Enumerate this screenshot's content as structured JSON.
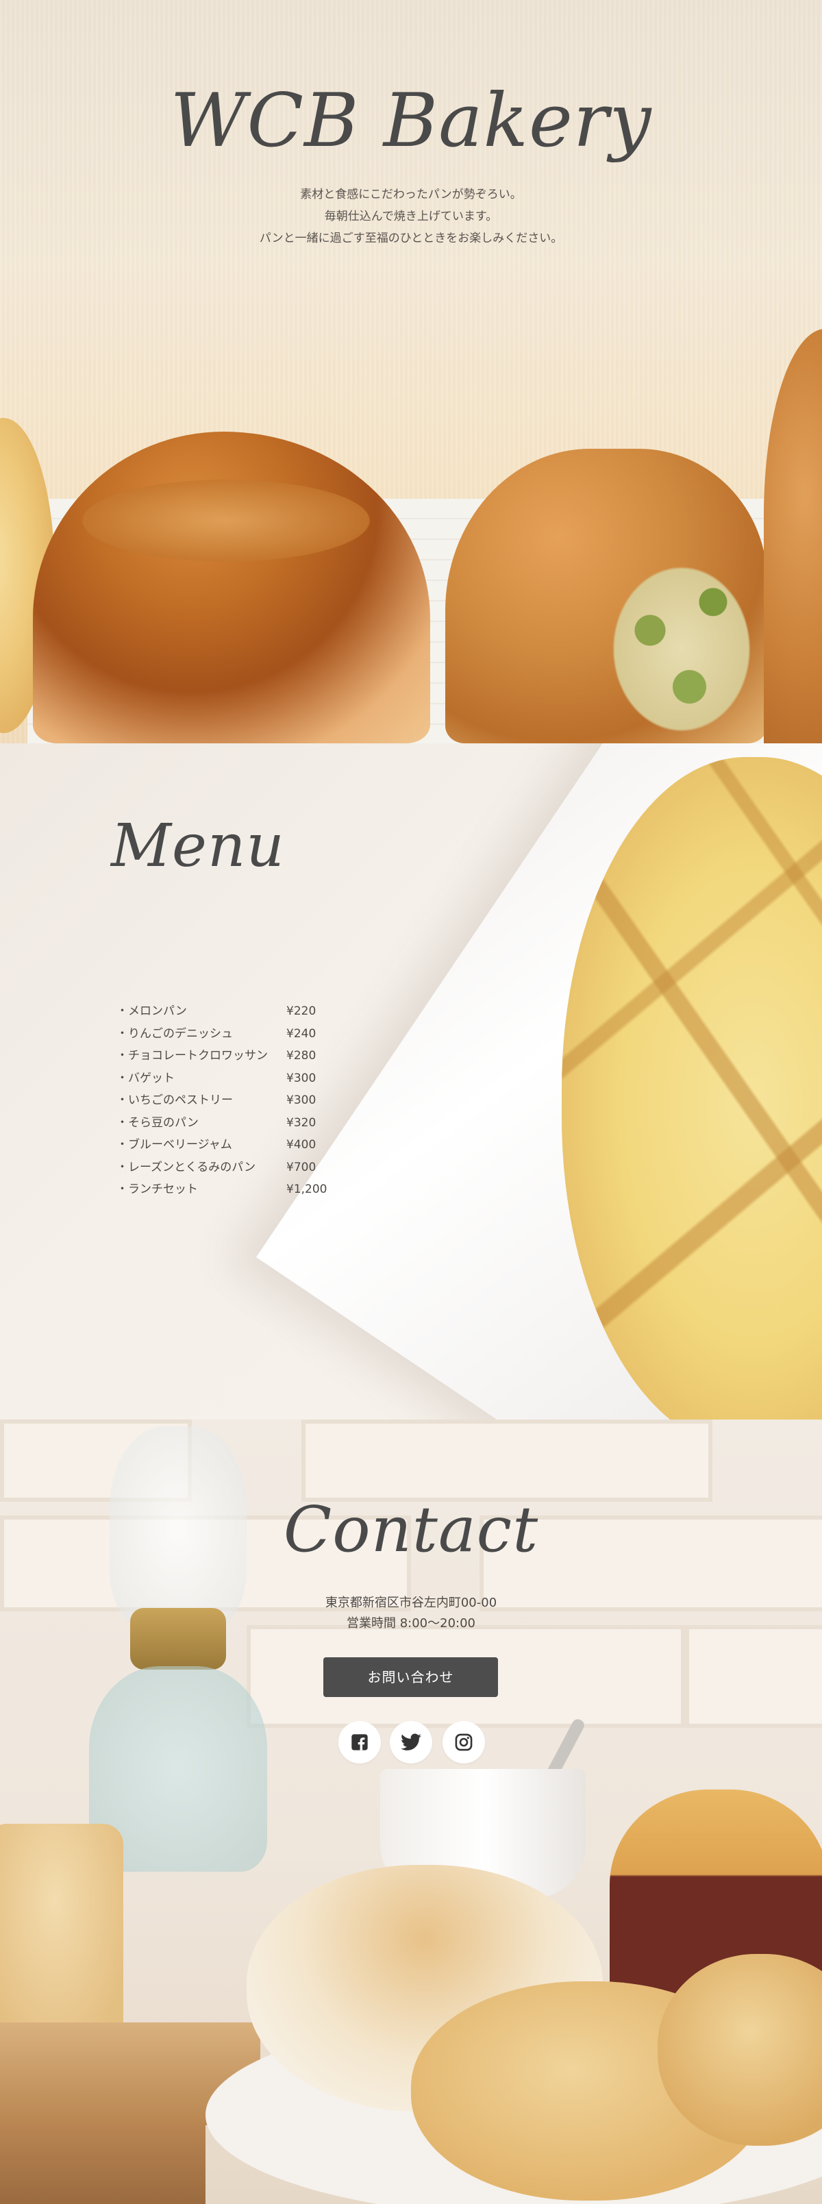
{
  "hero": {
    "title": "WCB Bakery",
    "lines": [
      "素材と食感にこだわったパンが勢ぞろい。",
      "毎朝仕込んで焼き上げています。",
      "パンと一緒に過ごす至福のひとときをお楽しみください。"
    ]
  },
  "menu": {
    "title": "Menu",
    "items": [
      {
        "name": "・メロンパン",
        "price": "¥220"
      },
      {
        "name": "・りんごのデニッシュ",
        "price": "¥240"
      },
      {
        "name": "・チョコレートクロワッサン",
        "price": "¥280"
      },
      {
        "name": "・バゲット",
        "price": "¥300"
      },
      {
        "name": "・いちごのペストリー",
        "price": "¥300"
      },
      {
        "name": "・そら豆のパン",
        "price": "¥320"
      },
      {
        "name": "・ブルーベリージャム",
        "price": "¥400"
      },
      {
        "name": "・レーズンとくるみのパン",
        "price": "¥700"
      },
      {
        "name": "・ランチセット",
        "price": "¥1,200"
      }
    ]
  },
  "contact": {
    "title": "Contact",
    "address": "東京都新宿区市谷左内町00-00",
    "hours": "営業時間 8:00〜20:00",
    "button_label": "お問い合わせ",
    "social": [
      {
        "name": "facebook",
        "icon": "facebook-icon"
      },
      {
        "name": "twitter",
        "icon": "twitter-icon"
      },
      {
        "name": "instagram",
        "icon": "instagram-icon"
      }
    ]
  },
  "colors": {
    "text": "#464646",
    "button_bg": "#4d4d4d",
    "button_text": "#ffffff",
    "icon_circle": "#ffffff"
  }
}
